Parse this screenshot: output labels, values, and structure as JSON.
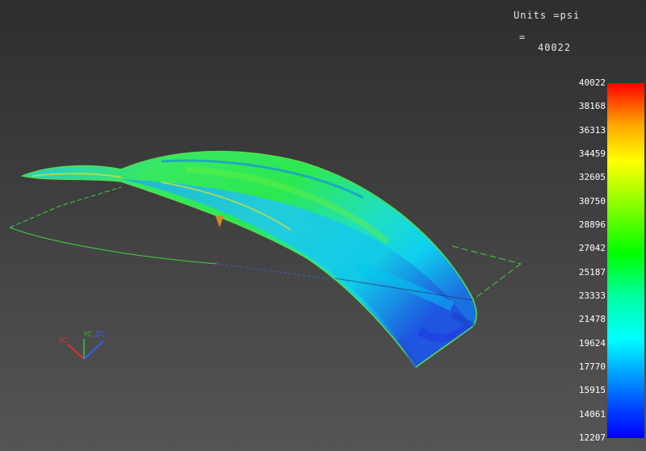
{
  "header": {
    "units_label": "Units =psi",
    "equals": "=",
    "max_value": "40022"
  },
  "legend": {
    "ticks": [
      "40022",
      "38168",
      "36313",
      "34459",
      "32605",
      "30750",
      "28896",
      "27042",
      "25187",
      "23333",
      "21478",
      "19624",
      "17770",
      "15915",
      "14061",
      "12207"
    ],
    "colors": {
      "max": "#ff0000",
      "high": "#ffff00",
      "mid": "#00ff00",
      "low_mid": "#00ffff",
      "min": "#0000ff"
    }
  },
  "triad": {
    "x": "XC",
    "y": "YC",
    "z": "ZC",
    "colors": {
      "x": "#e03030",
      "y": "#30b030",
      "z": "#3060ff"
    }
  }
}
